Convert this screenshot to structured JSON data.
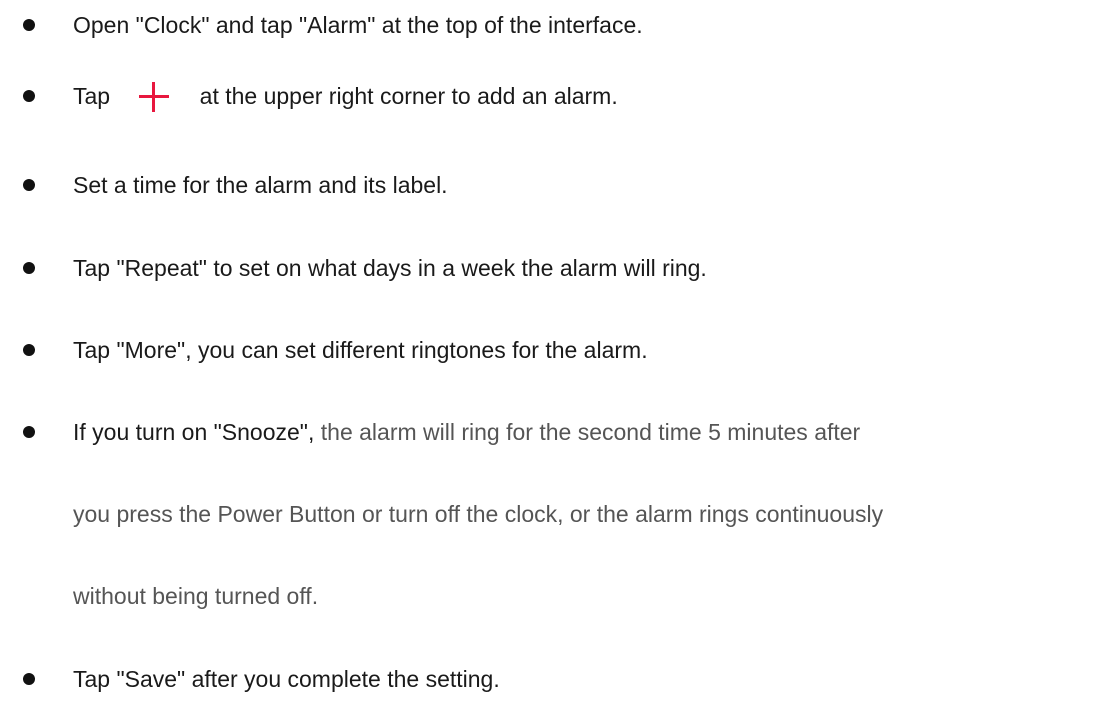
{
  "items": [
    {
      "text": "Open \"Clock\" and tap \"Alarm\" at the top of the interface."
    },
    {
      "before_icon": "Tap",
      "icon": "plus-icon",
      "after_icon": "at the upper right corner to add an alarm."
    },
    {
      "text": "Set a time for the alarm and its label."
    },
    {
      "text": "Tap \"Repeat\" to set on what days in a week the alarm will ring."
    },
    {
      "text": "Tap \"More\", you can set different ringtones for the alarm."
    },
    {
      "lead": "If you turn on \"Snooze\",",
      "rest_line1": "the alarm will ring for the second time 5 minutes after",
      "line2": "you press the Power Button or turn off the clock, or the alarm rings continuously",
      "line3": "without being turned off."
    },
    {
      "text": "Tap \"Save\" after you complete the setting."
    }
  ],
  "colors": {
    "plus_icon": "#e8173e",
    "bullet": "#111111",
    "secondary_text": "#555555"
  }
}
